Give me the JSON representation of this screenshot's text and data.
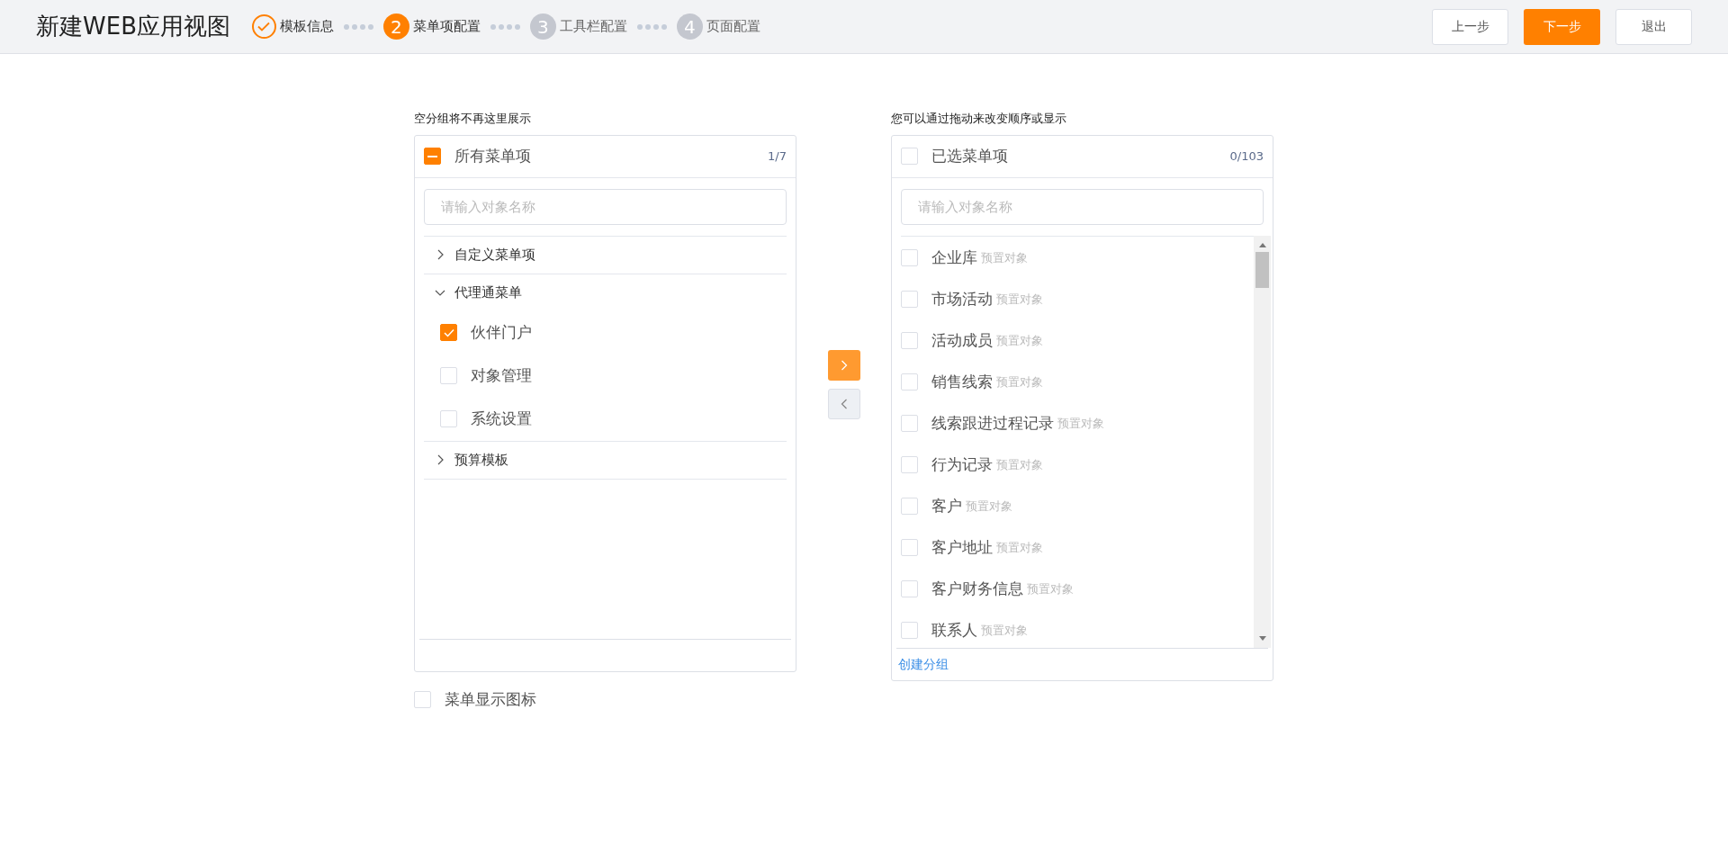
{
  "header": {
    "title": "新建WEB应用视图",
    "steps": [
      {
        "label": "模板信息",
        "kind": "done"
      },
      {
        "number": "2",
        "label": "菜单项配置",
        "kind": "current"
      },
      {
        "number": "3",
        "label": "工具栏配置",
        "kind": "pending"
      },
      {
        "number": "4",
        "label": "页面配置",
        "kind": "pending"
      }
    ],
    "buttons": [
      {
        "label": "上一步",
        "kind": "secondary"
      },
      {
        "label": "下一步",
        "kind": "primary"
      },
      {
        "label": "退出",
        "kind": "secondary"
      }
    ]
  },
  "left_panel": {
    "hint": "空分组将不再这里展示",
    "title": "所有菜单项",
    "indeterminate": true,
    "count": "1/7",
    "search": {
      "placeholder": "请输入对象名称"
    },
    "tree": [
      {
        "label": "自定义菜单项",
        "expanded": false
      },
      {
        "label": "代理通菜单",
        "expanded": true,
        "children": [
          {
            "label": "伙伴门户",
            "checked": true
          },
          {
            "label": "对象管理",
            "checked": false
          },
          {
            "label": "系统设置",
            "checked": false
          }
        ]
      },
      {
        "label": "预算模板",
        "expanded": false
      }
    ]
  },
  "transfer_buttons": [
    {
      "kind": "right",
      "enabled": true
    },
    {
      "kind": "left",
      "enabled": false
    }
  ],
  "show_icons": {
    "label": "菜单显示图标",
    "checked": false
  },
  "right_panel": {
    "hint": "您可以通过拖动来改变顺序或显示",
    "title": "已选菜单项",
    "checked": false,
    "count": "0/103",
    "search": {
      "placeholder": "请输入对象名称"
    },
    "items": [
      {
        "label": "企业库",
        "tag": "预置对象",
        "checked": false
      },
      {
        "label": "市场活动",
        "tag": "预置对象",
        "checked": false
      },
      {
        "label": "活动成员",
        "tag": "预置对象",
        "checked": false
      },
      {
        "label": "销售线索",
        "tag": "预置对象",
        "checked": false
      },
      {
        "label": "线索跟进过程记录",
        "tag": "预置对象",
        "checked": false
      },
      {
        "label": "行为记录",
        "tag": "预置对象",
        "checked": false
      },
      {
        "label": "客户",
        "tag": "预置对象",
        "checked": false
      },
      {
        "label": "客户地址",
        "tag": "预置对象",
        "checked": false
      },
      {
        "label": "客户财务信息",
        "tag": "预置对象",
        "checked": false
      },
      {
        "label": "联系人",
        "tag": "预置对象",
        "checked": false
      }
    ],
    "footer_link": "创建分组"
  }
}
